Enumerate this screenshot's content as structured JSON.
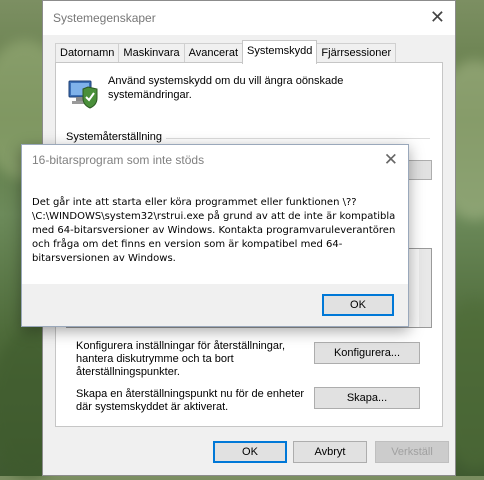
{
  "main_window": {
    "title": "Systemegenskaper",
    "tabs": [
      {
        "label": "Datornamn",
        "active": false
      },
      {
        "label": "Maskinvara",
        "active": false
      },
      {
        "label": "Avancerat",
        "active": false
      },
      {
        "label": "Systemskydd",
        "active": true
      },
      {
        "label": "Fjärrsessioner",
        "active": false
      }
    ],
    "intro_text": "Använd systemskydd om du vill ängra oönskade systemändringar.",
    "restore_group_label": "Systemåterställning",
    "configure_text": "Konfigurera inställningar för återställningar, hantera diskutrymme och ta bort återställningspunkter.",
    "configure_button": "Konfigurera...",
    "create_text": "Skapa en återställningspunkt nu för de enheter där systemskyddet är aktiverat.",
    "create_button": "Skapa...",
    "ok_button": "OK",
    "cancel_button": "Avbryt",
    "apply_button": "Verkställ"
  },
  "error_dialog": {
    "title": "16-bitarsprogram som inte stöds",
    "message": "Det går inte att starta eller köra programmet eller funktionen \\??\\C:\\WINDOWS\\system32\\rstrui.exe på grund av att de inte är kompatibla med 64-bitarsversioner av Windows. Kontakta programvaruleverantören och fråga om det finns en version som är kompatibel med 64-bitarsversionen av Windows.",
    "ok_button": "OK"
  },
  "icons": {
    "close": "close-icon",
    "system_protection": "system-protection-icon"
  }
}
